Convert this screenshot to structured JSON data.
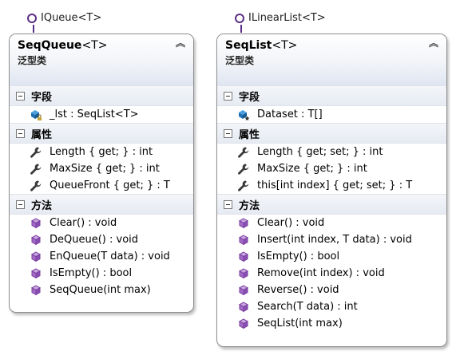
{
  "queue": {
    "interface": "IQueue<T>",
    "name": "SeqQueue",
    "type_params": "<T>",
    "subtitle": "泛型类",
    "sections": {
      "fields_label": "字段",
      "properties_label": "属性",
      "methods_label": "方法"
    },
    "fields": [
      "_lst : SeqList<T>"
    ],
    "properties": [
      "Length { get; } : int",
      "MaxSize { get; } : int",
      "QueueFront { get; } : T"
    ],
    "methods": [
      "Clear() : void",
      "DeQueue() : void",
      "EnQueue(T data) : void",
      "IsEmpty() : bool",
      "SeqQueue(int max)"
    ]
  },
  "list": {
    "interface": "ILinearList<T>",
    "name": "SeqList",
    "type_params": "<T>",
    "subtitle": "泛型类",
    "sections": {
      "fields_label": "字段",
      "properties_label": "属性",
      "methods_label": "方法"
    },
    "fields": [
      "Dataset : T[]"
    ],
    "properties": [
      "Length { get; set; } : int",
      "MaxSize { get; } : int",
      "this[int index] { get; set; } : T"
    ],
    "methods": [
      "Clear() : void",
      "Insert(int index, T data) : void",
      "IsEmpty() : bool",
      "Remove(int index) : void",
      "Reverse() : void",
      "Search(T data) : int",
      "SeqList(int max)"
    ]
  },
  "icons": {
    "collapse": "double-chevron-up-icon",
    "field_private": "field-lock-icon",
    "field_protected": "field-star-icon",
    "property": "wrench-icon",
    "method": "method-cube-icon"
  },
  "colors": {
    "lollipop": "#5b2f86",
    "method_cube": "#7b3fa0",
    "field_cube": "#1f6fb2"
  }
}
